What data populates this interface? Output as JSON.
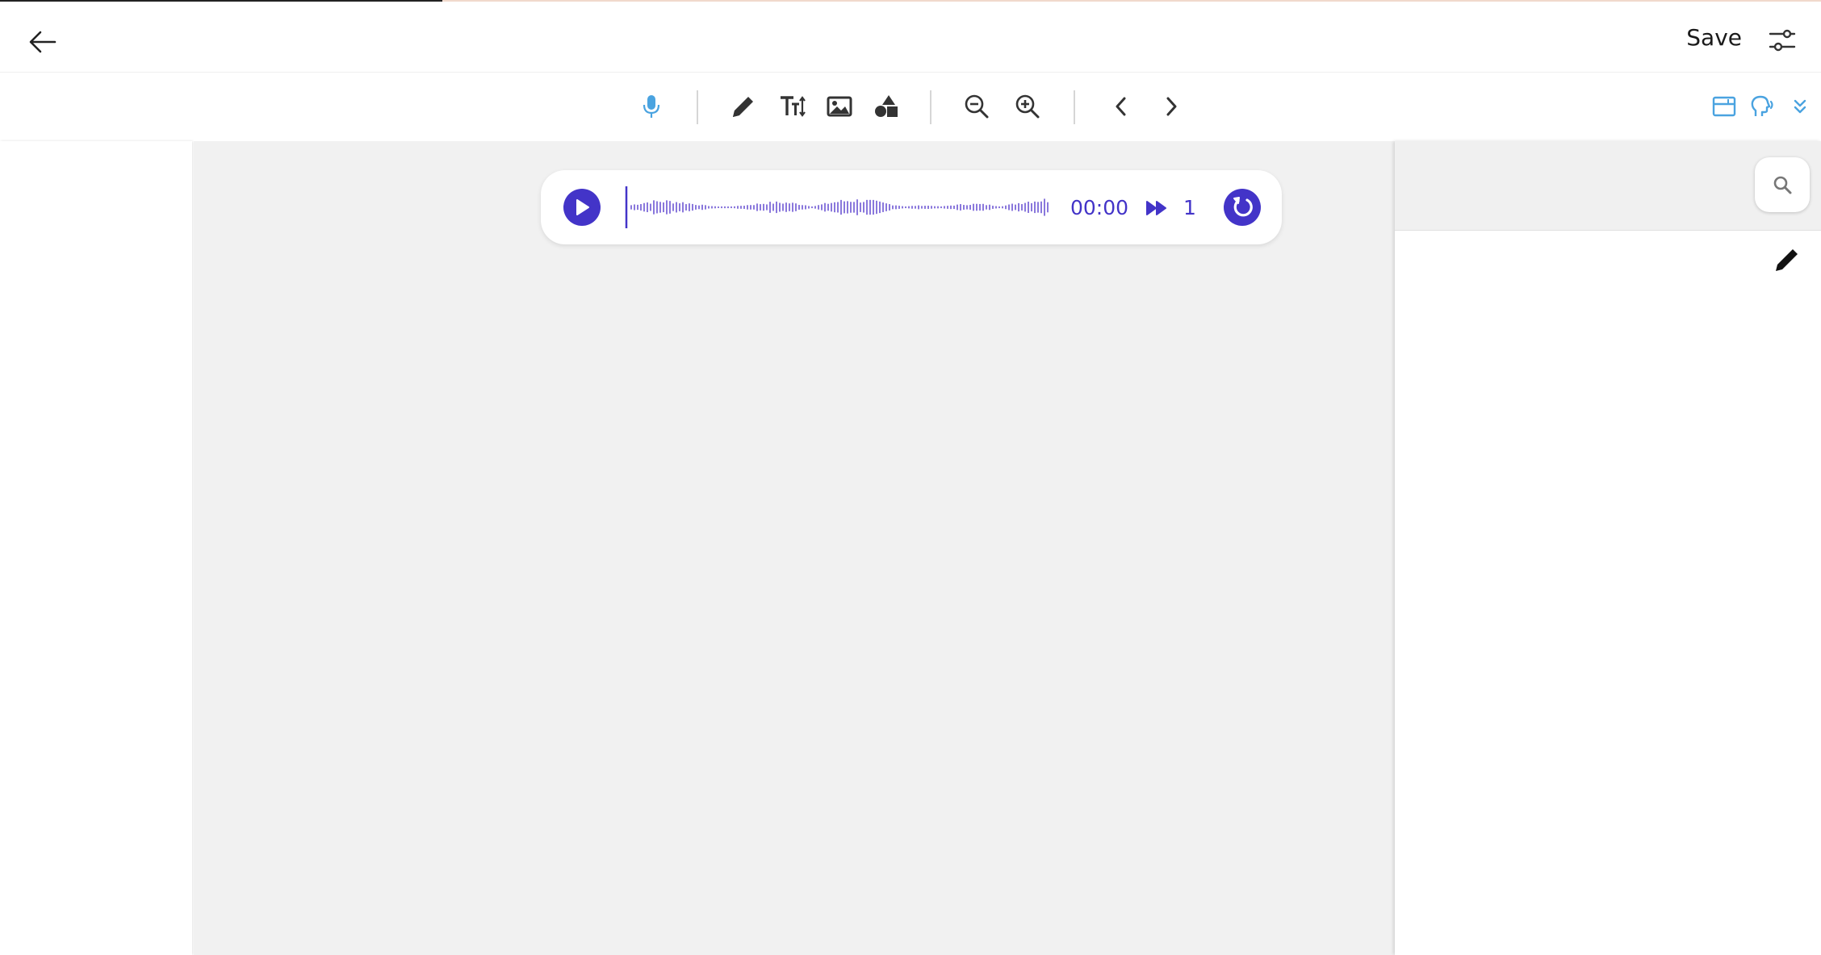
{
  "progress": {
    "fraction": 0.243,
    "fill_color": "#222222",
    "track_color": "#f1d9cc"
  },
  "header": {
    "back_icon": "arrow-left-icon",
    "save_label": "Save",
    "settings_icon": "sliders-icon"
  },
  "toolbar": {
    "items": [
      {
        "icon": "microphone-icon",
        "color": "#4aa3e0"
      },
      {
        "icon": "pencil-icon",
        "color": "#333333"
      },
      {
        "icon": "text-size-icon",
        "color": "#333333"
      },
      {
        "icon": "image-icon",
        "color": "#333333"
      },
      {
        "icon": "shapes-icon",
        "color": "#333333"
      },
      {
        "icon": "zoom-out-icon",
        "color": "#333333"
      },
      {
        "icon": "zoom-in-icon",
        "color": "#333333"
      },
      {
        "icon": "chevron-left-icon",
        "color": "#333333"
      },
      {
        "icon": "chevron-right-icon",
        "color": "#333333"
      },
      {
        "icon": "panel-layout-icon",
        "color": "#4aa3e0"
      },
      {
        "icon": "speaking-head-icon",
        "color": "#4aa3e0"
      },
      {
        "icon": "double-chevron-down-icon",
        "color": "#4aa3e0"
      }
    ]
  },
  "player": {
    "time": "00:00",
    "speed": "1",
    "position_fraction": 0,
    "accent_color": "#4334c8",
    "wave_color": "#8a78dc",
    "icons": [
      "play-icon",
      "waveform-icon",
      "fast-forward-icon",
      "restart-icon"
    ]
  },
  "right_panel": {
    "search_icon": "search-icon",
    "edit_icon": "pencil-icon"
  }
}
